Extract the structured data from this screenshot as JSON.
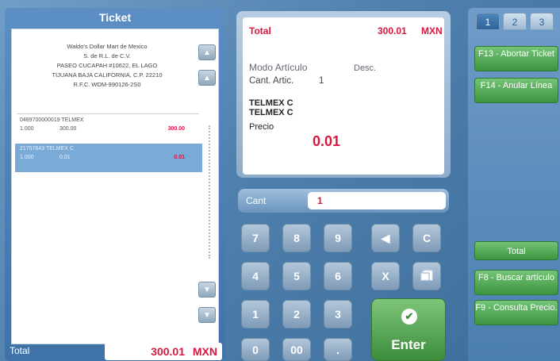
{
  "ticket": {
    "title": "Ticket",
    "header_lines": [
      "Waldo's Dollar Mart de Mexico",
      "S. de R.L. de C.V.",
      "PASEO CUCAPAH #10622, EL LAGO",
      "TIJUANA BAJA CALIFORNIA, C.P. 22210",
      "R.F.C. WDM-990126-2S0"
    ],
    "items": [
      {
        "code": "0489700000019  TELMEX",
        "qty": "1.000",
        "unit": "300.00",
        "amount": "300.00",
        "selected": false
      },
      {
        "code": "21757643  TELMEX C",
        "qty": "1.000",
        "unit": "0.01",
        "amount": "0.01",
        "selected": true
      }
    ]
  },
  "total": {
    "label": "Total",
    "value": "300.01",
    "currency": "MXN"
  },
  "display": {
    "total_label": "Total",
    "total_value": "300.01",
    "currency": "MXN",
    "mode_label": "Modo Artículo",
    "desc_label": "Desc.",
    "qty_label": "Cant. Artic.",
    "qty_value": "1",
    "desc_lines": [
      "TELMEX C",
      "TELMEX C"
    ],
    "price_label": "Precio",
    "price_value": "0.01"
  },
  "keypad": {
    "qty_label": "Cant",
    "qty_value": "1",
    "keys": [
      "7",
      "8",
      "9",
      "4",
      "5",
      "6",
      "1",
      "2",
      "3",
      "0",
      "00",
      "."
    ],
    "backspace_symbol": "◀",
    "clear_label": "C",
    "cancel_label": "X",
    "enter_label": "Enter"
  },
  "function_panel": {
    "tabs": [
      "1",
      "2",
      "3"
    ],
    "active_tab": "1",
    "buttons": [
      "F13 - Abortar Ticket",
      "F14 - Anular Línea",
      "Total",
      "F8 - Buscar artículo",
      "F9 - Consulta Precio."
    ]
  },
  "colors": {
    "accent_red": "#d8173f",
    "button_green": "#3c9440",
    "panel_blue": "#4f80ad"
  },
  "icons": [
    "scroll-up-icon",
    "scroll-down-icon",
    "scroll-bottom-icon",
    "backspace-icon",
    "drawer-icon",
    "check-icon"
  ]
}
